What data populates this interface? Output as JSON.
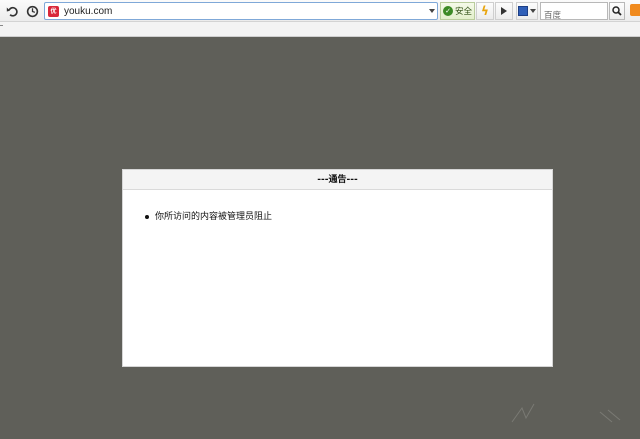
{
  "browser": {
    "address_bar": {
      "url": "youku.com",
      "site_icon_label": "优"
    },
    "safety_badge": {
      "label": "安全"
    },
    "search": {
      "placeholder": "百度"
    },
    "icons": {
      "back": "undo-icon",
      "history": "clock-icon",
      "dropdown": "chevron-down-icon",
      "safe": "check-shield-icon",
      "accelerate": "lightning-icon",
      "media": "play-icon",
      "engine": "search-engine-icon",
      "search": "magnifier-icon",
      "feed": "rss-icon"
    }
  },
  "notice": {
    "title": "---通告---",
    "items": [
      "你所访问的内容被管理员阻止"
    ]
  },
  "colors": {
    "page_background": "#5f5f59",
    "panel_background": "#ffffff",
    "safe_green": "#3c8a25",
    "lightning_yellow": "#e8a40c"
  }
}
